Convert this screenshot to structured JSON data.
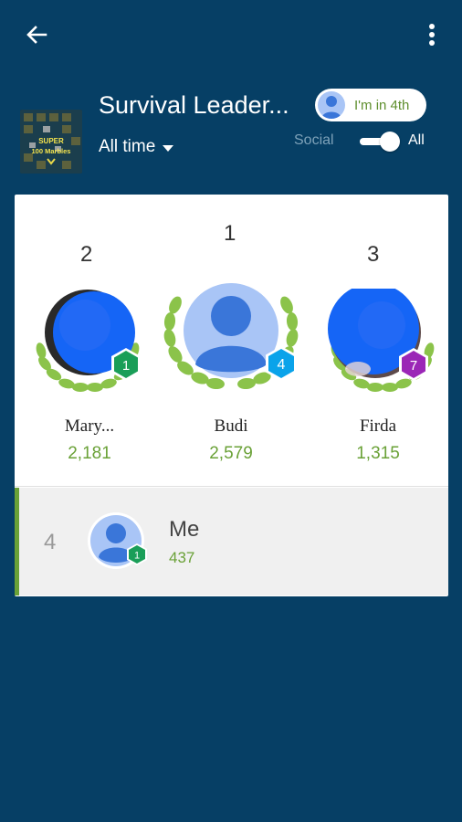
{
  "toolbar": {
    "back_icon": "arrow-back-icon",
    "menu_icon": "more-vert-icon"
  },
  "header": {
    "title": "Survival Leader...",
    "timespan": "All time",
    "game_image_text": [
      "SUPER",
      "100 Marbles"
    ],
    "my_rank_text": "I'm in 4th",
    "social_label": "Social",
    "all_label": "All",
    "filter_all_selected": true
  },
  "podium": [
    {
      "rank": "2",
      "name": "Mary...",
      "score": "2,181",
      "level": "1",
      "level_color": "#1a9e58"
    },
    {
      "rank": "1",
      "name": "Budi",
      "score": "2,579",
      "level": "4",
      "level_color": "#0aa3ea"
    },
    {
      "rank": "3",
      "name": "Firda",
      "score": "1,315",
      "level": "7",
      "level_color": "#9b26b6"
    }
  ],
  "me": {
    "rank": "4",
    "name": "Me",
    "score": "437",
    "level": "1",
    "level_color": "#1a9e58"
  },
  "colors": {
    "background": "#063f65",
    "score_green": "#6aa137",
    "laurel_green": "#8bc34a",
    "avatar_blue": "#1565f6"
  }
}
